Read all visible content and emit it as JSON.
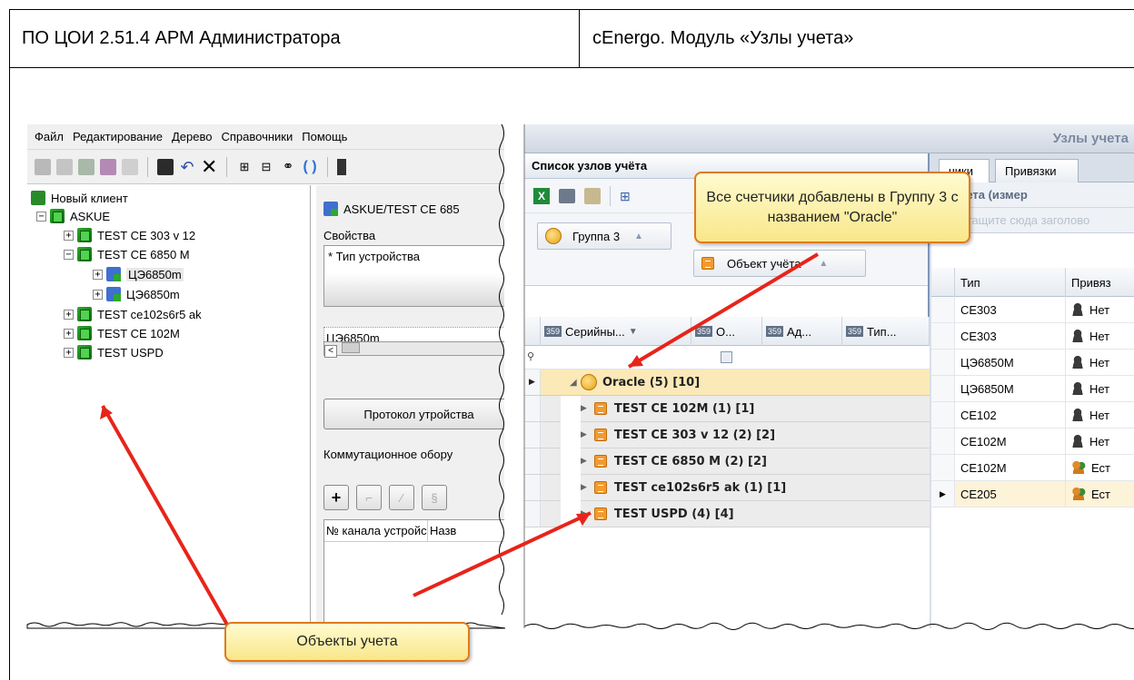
{
  "header": {
    "left_title": "ПО ЦОИ 2.51.4 АРМ Администратора",
    "right_title": "cEnergo. Модуль «Узлы учета»"
  },
  "left_app": {
    "menu": [
      "Файл",
      "Редактирование",
      "Дерево",
      "Справочники",
      "Помощь"
    ],
    "tree": {
      "root": "Новый клиент",
      "askue": "ASKUE",
      "items": [
        {
          "label": "TEST CE 303 v 12",
          "exp": "+"
        },
        {
          "label": "TEST CE 6850 M",
          "exp": "−"
        },
        {
          "label": "ЦЭ6850m",
          "exp": "+",
          "child": true,
          "selected": true
        },
        {
          "label": "ЦЭ6850m",
          "exp": "+",
          "child": true
        },
        {
          "label": "TEST ce102s6r5 ak",
          "exp": "+"
        },
        {
          "label": "TEST CE 102M",
          "exp": "+"
        },
        {
          "label": "TEST USPD",
          "exp": "+"
        }
      ]
    },
    "props": {
      "path": "ASKUE/TEST CE 685",
      "section": "Свойства",
      "device_type_label": "* Тип устройства",
      "device_value": "ЦЭ6850m",
      "protocol_button": "Протокол утройства",
      "switching_label": "Коммутационное обору",
      "channel_col": "№ канала устройс",
      "name_col": "Назв"
    }
  },
  "right_app": {
    "window_title": "Узлы учета",
    "list_title": "Список узлов учёта",
    "group_chip": "Группа 3",
    "object_chip": "Объект учёта",
    "columns": [
      "Серийны...",
      "О...",
      "Ад...",
      "Тип..."
    ],
    "group_row": "Oracle (5) [10]",
    "objects": [
      "TEST CE 102M (1) [1]",
      "TEST CE 303 v 12 (2) [2]",
      "TEST CE 6850 M (2) [2]",
      "TEST ce102s6r5 ak (1) [1]",
      "TEST USPD (4) [4]"
    ],
    "tabs": [
      "чики",
      "Привязки"
    ],
    "sub_title": "р учета (измер",
    "drop_hint": "Перетащите сюда заголово",
    "right_cols": [
      "Тип",
      "Привяз"
    ],
    "right_rows": [
      {
        "type": "CE303",
        "bind": "Нет",
        "icon": "person-icon"
      },
      {
        "type": "CE303",
        "bind": "Нет",
        "icon": "person-icon"
      },
      {
        "type": "ЦЭ6850M",
        "bind": "Нет",
        "icon": "person-icon"
      },
      {
        "type": "ЦЭ6850M",
        "bind": "Нет",
        "icon": "person-icon"
      },
      {
        "type": "CE102",
        "bind": "Нет",
        "icon": "person-icon"
      },
      {
        "type": "CE102M",
        "bind": "Нет",
        "icon": "person-icon"
      },
      {
        "type": "CE102M",
        "bind": "Ест",
        "icon": "persons-icon"
      },
      {
        "type": "CE205",
        "bind": "Ест",
        "icon": "persons-icon",
        "current": true
      }
    ]
  },
  "callouts": {
    "top": "Все счетчики добавлены в Группу 3 с названием \"Oracle\"",
    "bottom": "Объекты учета"
  },
  "colors": {
    "callout_border": "#e07a1a",
    "callout_fill": "#f9e78a",
    "arrow": "#e8241a",
    "group_row": "#fbe9b8"
  }
}
